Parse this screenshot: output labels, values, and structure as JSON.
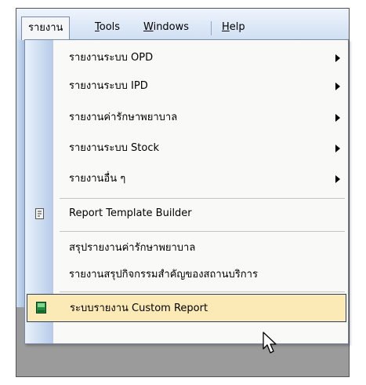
{
  "menubar": {
    "items": [
      {
        "label": "รายงาน",
        "active": true
      },
      {
        "label_underline": "T",
        "label_rest": "ools"
      },
      {
        "label_underline": "W",
        "label_rest": "indows"
      },
      {
        "label_underline": "H",
        "label_rest": "elp"
      }
    ]
  },
  "menu": {
    "items": [
      {
        "label": "รายงานระบบ OPD",
        "submenu": true
      },
      {
        "label": "รายงานระบบ IPD",
        "submenu": true
      },
      {
        "label": "รายงานค่ารักษาพยาบาล",
        "submenu": true
      },
      {
        "label": "รายงานระบบ Stock",
        "submenu": true
      },
      {
        "label": "รายงานอื่น ๆ",
        "submenu": true
      },
      {
        "label": "Report Template Builder",
        "icon": "document-list-icon"
      },
      {
        "label": "สรุปรายงานค่ารักษาพยาบาล"
      },
      {
        "label": "รายงานสรุปกิจกรรมสำคัญของสถานบริการ"
      },
      {
        "label": "ระบบรายงาน Custom Report",
        "icon": "green-book-icon",
        "highlighted": true
      }
    ]
  },
  "colors": {
    "highlight": "#fbe9b6",
    "highlight_border": "#2f3e5c",
    "gutter": "#b6cbe8",
    "background_dark": "#9b9b9b"
  }
}
